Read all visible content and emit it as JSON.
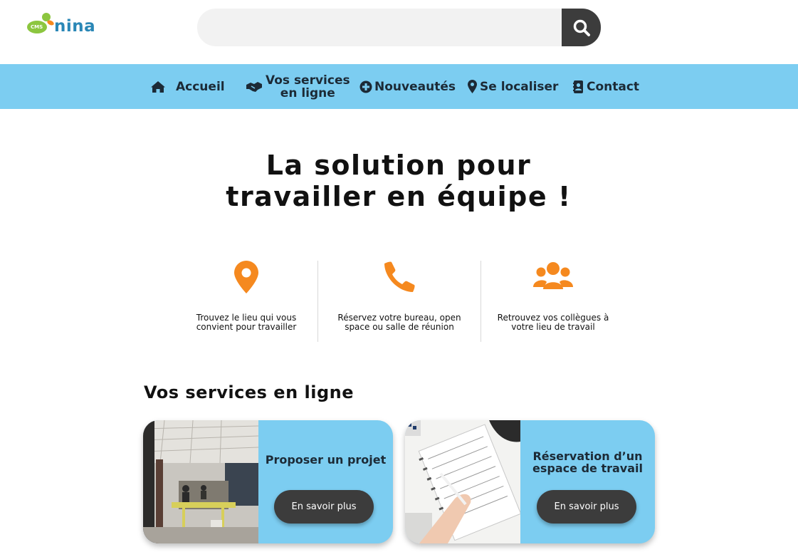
{
  "header": {
    "logo_small": "CMS",
    "logo_text": "nina",
    "search_placeholder": ""
  },
  "nav": {
    "items": [
      {
        "label": "Accueil",
        "icon": "home-icon"
      },
      {
        "label": "Vos services en ligne",
        "line1": "Vos services",
        "line2": "en ligne",
        "icon": "handshake-icon"
      },
      {
        "label": "Nouveautés",
        "icon": "plus-circle-icon"
      },
      {
        "label": "Se localiser",
        "icon": "map-marker-icon"
      },
      {
        "label": "Contact",
        "icon": "address-book-icon"
      }
    ]
  },
  "hero": {
    "line1": "La solution pour",
    "line2": "travailler en équipe !"
  },
  "features": [
    {
      "icon": "map-marker-icon",
      "text": "Trouvez le lieu qui vous convient pour travailler"
    },
    {
      "icon": "phone-icon",
      "text": "Réservez votre bureau, open space ou salle de réunion"
    },
    {
      "icon": "users-icon",
      "text": "Retrouvez vos collègues à votre lieu de travail"
    }
  ],
  "services": {
    "title": "Vos services en ligne",
    "cards": [
      {
        "title": "Proposer un projet",
        "button": "En savoir plus",
        "image": "office-photo"
      },
      {
        "title": "Réservation d'un espace de travail",
        "line1": "Réservation d’un",
        "line2": "espace de travail",
        "button": "En savoir plus",
        "image": "planner-photo"
      }
    ]
  },
  "colors": {
    "nav_bg": "#7ccdf1",
    "accent_orange": "#f5891f",
    "button_dark": "#3c3c3c",
    "logo_green": "#8cc63f",
    "logo_blue": "#2a87b6"
  }
}
